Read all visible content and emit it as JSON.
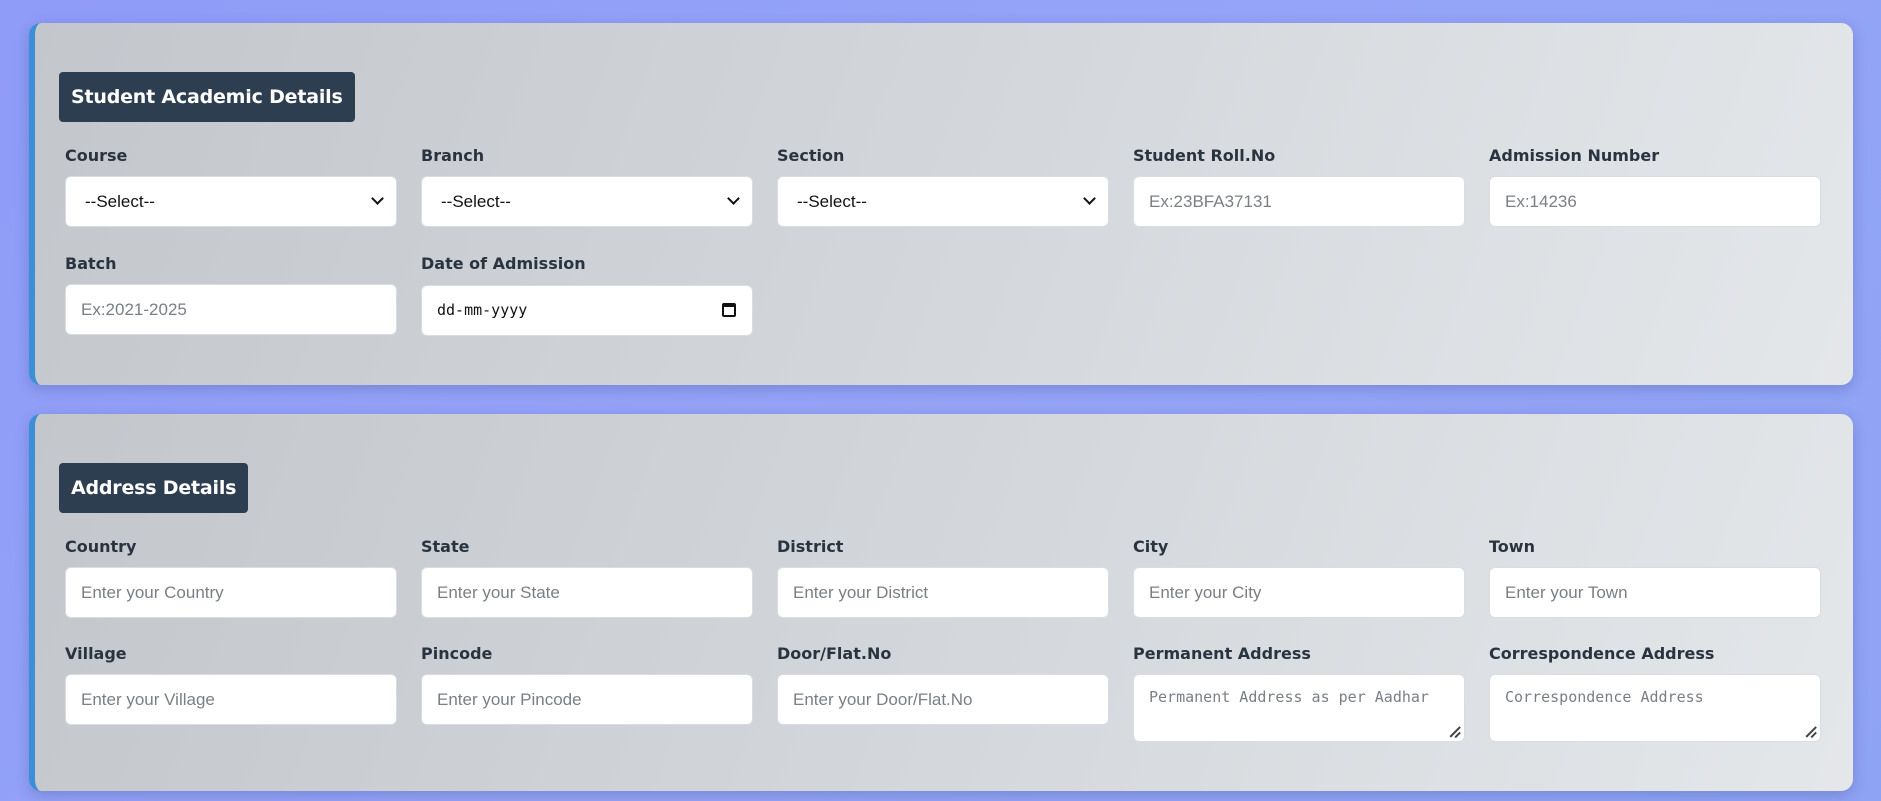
{
  "academic": {
    "title": "Student Academic Details",
    "fields": {
      "course": {
        "label": "Course",
        "value": "--Select--"
      },
      "branch": {
        "label": "Branch",
        "value": "--Select--"
      },
      "section": {
        "label": "Section",
        "value": "--Select--"
      },
      "roll": {
        "label": "Student Roll.No",
        "placeholder": "Ex:23BFA37131"
      },
      "admission_number": {
        "label": "Admission Number",
        "placeholder": "Ex:14236"
      },
      "batch": {
        "label": "Batch",
        "placeholder": "Ex:2021-2025"
      },
      "admission_date": {
        "label": "Date of Admission",
        "placeholder": "dd-mm-yyyy"
      }
    }
  },
  "address": {
    "title": "Address Details",
    "fields": {
      "country": {
        "label": "Country",
        "placeholder": "Enter your Country"
      },
      "state": {
        "label": "State",
        "placeholder": "Enter your State"
      },
      "district": {
        "label": "District",
        "placeholder": "Enter your District"
      },
      "city": {
        "label": "City",
        "placeholder": "Enter your City"
      },
      "town": {
        "label": "Town",
        "placeholder": "Enter your Town"
      },
      "village": {
        "label": "Village",
        "placeholder": "Enter your Village"
      },
      "pincode": {
        "label": "Pincode",
        "placeholder": "Enter your Pincode"
      },
      "door": {
        "label": "Door/Flat.No",
        "placeholder": "Enter your Door/Flat.No"
      },
      "permanent": {
        "label": "Permanent Address",
        "placeholder": "Permanent Address as per Aadhar"
      },
      "correspondence": {
        "label": "Correspondence Address",
        "placeholder": "Correspondence Address"
      }
    }
  },
  "colors": {
    "background": "#8f9cf8",
    "title_bg": "#2d3e50",
    "card_accent": "#3a8fd6"
  },
  "icons": {
    "select": "chevron-down-icon",
    "date": "calendar-icon",
    "textarea": "resize-handle-icon"
  }
}
